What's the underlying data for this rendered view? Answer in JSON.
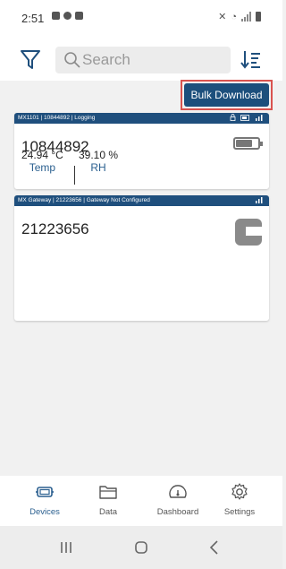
{
  "status_bar": {
    "time": "2:51"
  },
  "toolbar": {
    "search_placeholder": "Search",
    "filter_icon": "filter-icon",
    "sort_icon": "sort-icon"
  },
  "bulk_download": {
    "label": "Bulk Download"
  },
  "devices": [
    {
      "header": "MX1101 | 10844892 | Logging",
      "serial": "10844892",
      "readings": [
        {
          "value": "24.94 °C",
          "label": "Temp"
        },
        {
          "value": "39.10 %",
          "label": "RH"
        }
      ]
    },
    {
      "header": "MX Gateway | 21223656 | Gateway Not Configured",
      "serial": "21223656"
    }
  ],
  "nav": [
    {
      "label": "Devices",
      "icon": "devices-icon",
      "active": true
    },
    {
      "label": "Data",
      "icon": "folder-icon"
    },
    {
      "label": "Dashboard",
      "icon": "dashboard-icon"
    },
    {
      "label": "Settings",
      "icon": "gear-icon"
    }
  ],
  "colors": {
    "accent": "#1f4f7d",
    "highlight_border": "#d9534f",
    "active_nav": "#2a5f8f"
  }
}
